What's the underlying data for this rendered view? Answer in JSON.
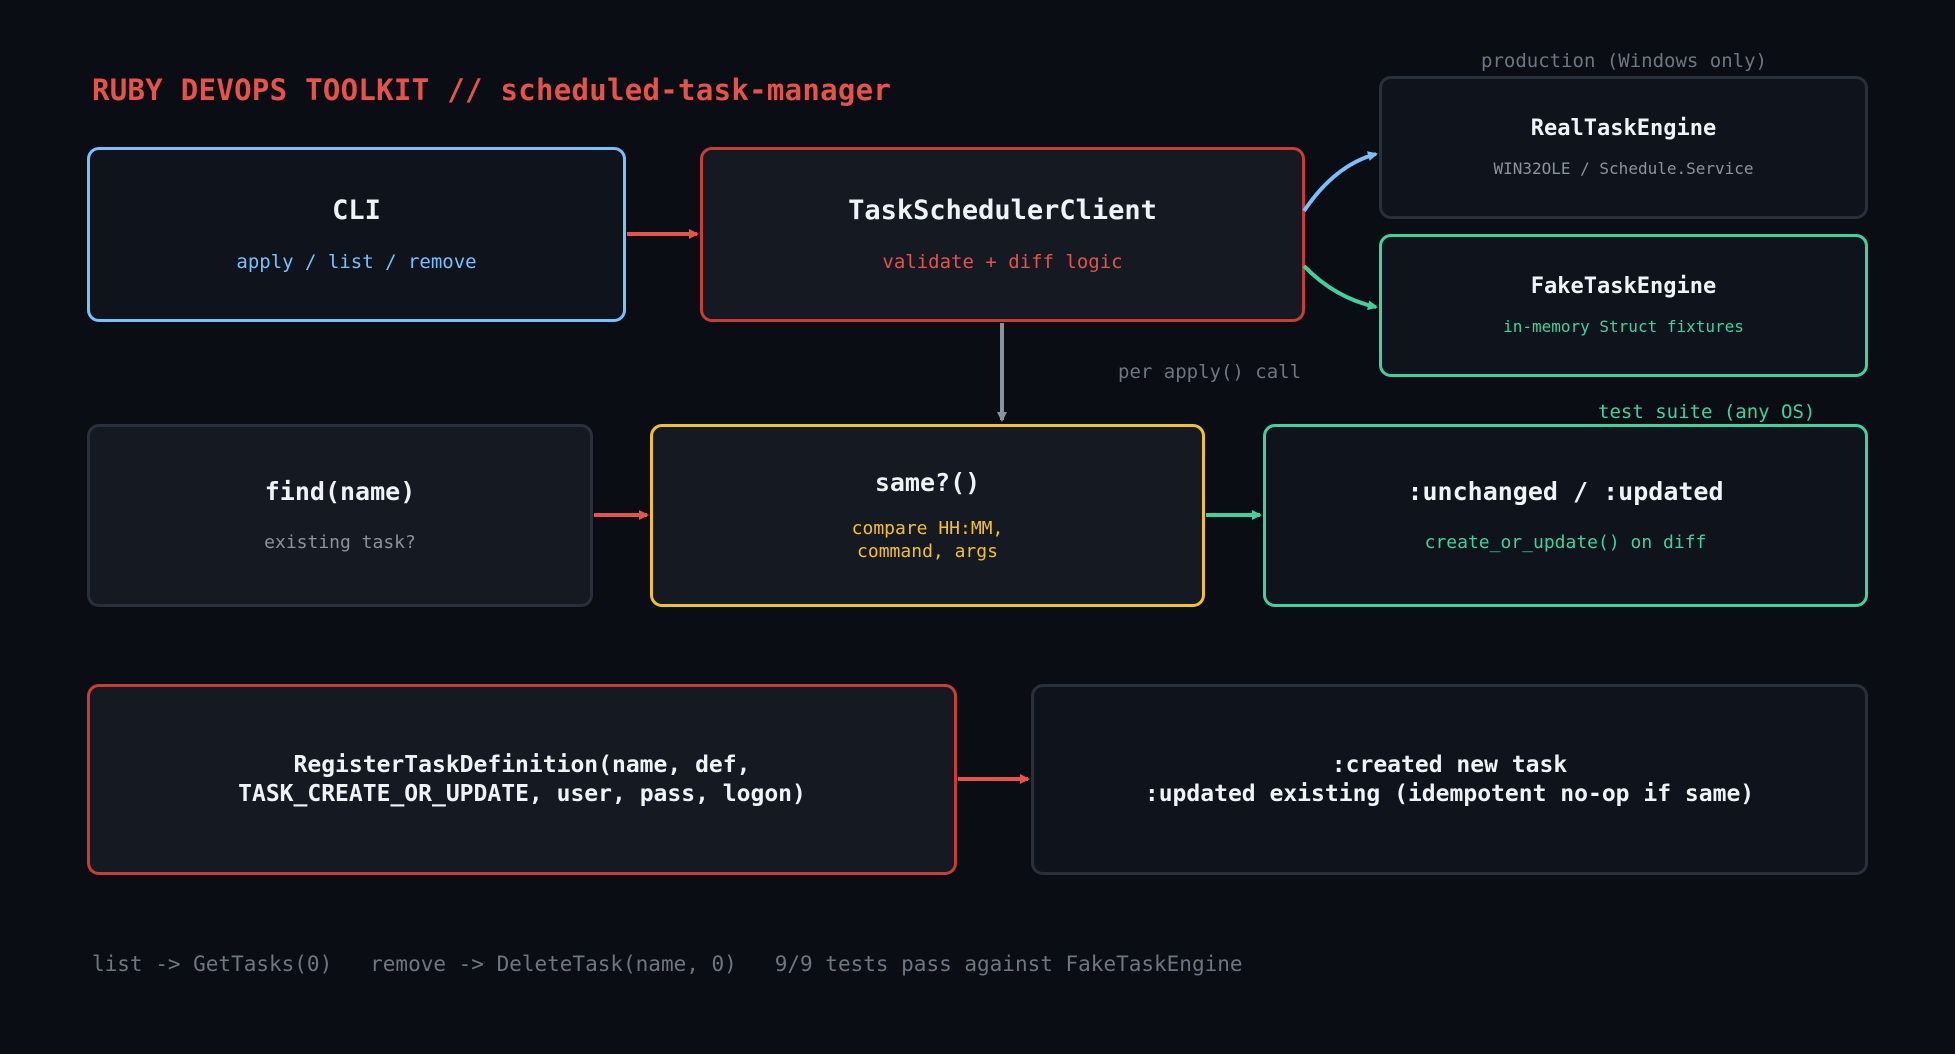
{
  "title": "RUBY DEVOPS TOOLKIT // scheduled-task-manager",
  "colors": {
    "background": "#0a0d14",
    "title": "#e5534b",
    "blue": "#79c0ff",
    "red": "#e5534b",
    "red_border": "#c93c37",
    "green": "#3fd39b",
    "yellow": "#f2c12e",
    "gray": "#8b949e",
    "muted": "#6e7681"
  },
  "nodes": {
    "cli": {
      "name": "CLI",
      "sub": "apply / list / remove"
    },
    "client": {
      "name": "TaskSchedulerClient",
      "sub": "validate + diff logic"
    },
    "real_engine": {
      "name": "RealTaskEngine",
      "sub": "WIN32OLE / Schedule.Service"
    },
    "fake_engine": {
      "name": "FakeTaskEngine",
      "sub": "in-memory Struct fixtures"
    },
    "find": {
      "name": "find(name)",
      "sub": "existing task?"
    },
    "same": {
      "name": "same?()",
      "sub": "compare HH:MM,\ncommand, args"
    },
    "result": {
      "name": ":unchanged / :updated",
      "sub": "create_or_update() on diff"
    },
    "register": {
      "name": "RegisterTaskDefinition(name, def,\nTASK_CREATE_OR_UPDATE, user, pass, logon)"
    },
    "outcome": {
      "name": ":created new task\n:updated existing (idempotent no-op if same)"
    }
  },
  "notes": {
    "production": "production (Windows only)",
    "per_apply": "per apply() call",
    "test_suite": "test suite (any OS)"
  },
  "footer": "list -> GetTasks(0)   remove -> DeleteTask(name, 0)   9/9 tests pass against FakeTaskEngine"
}
